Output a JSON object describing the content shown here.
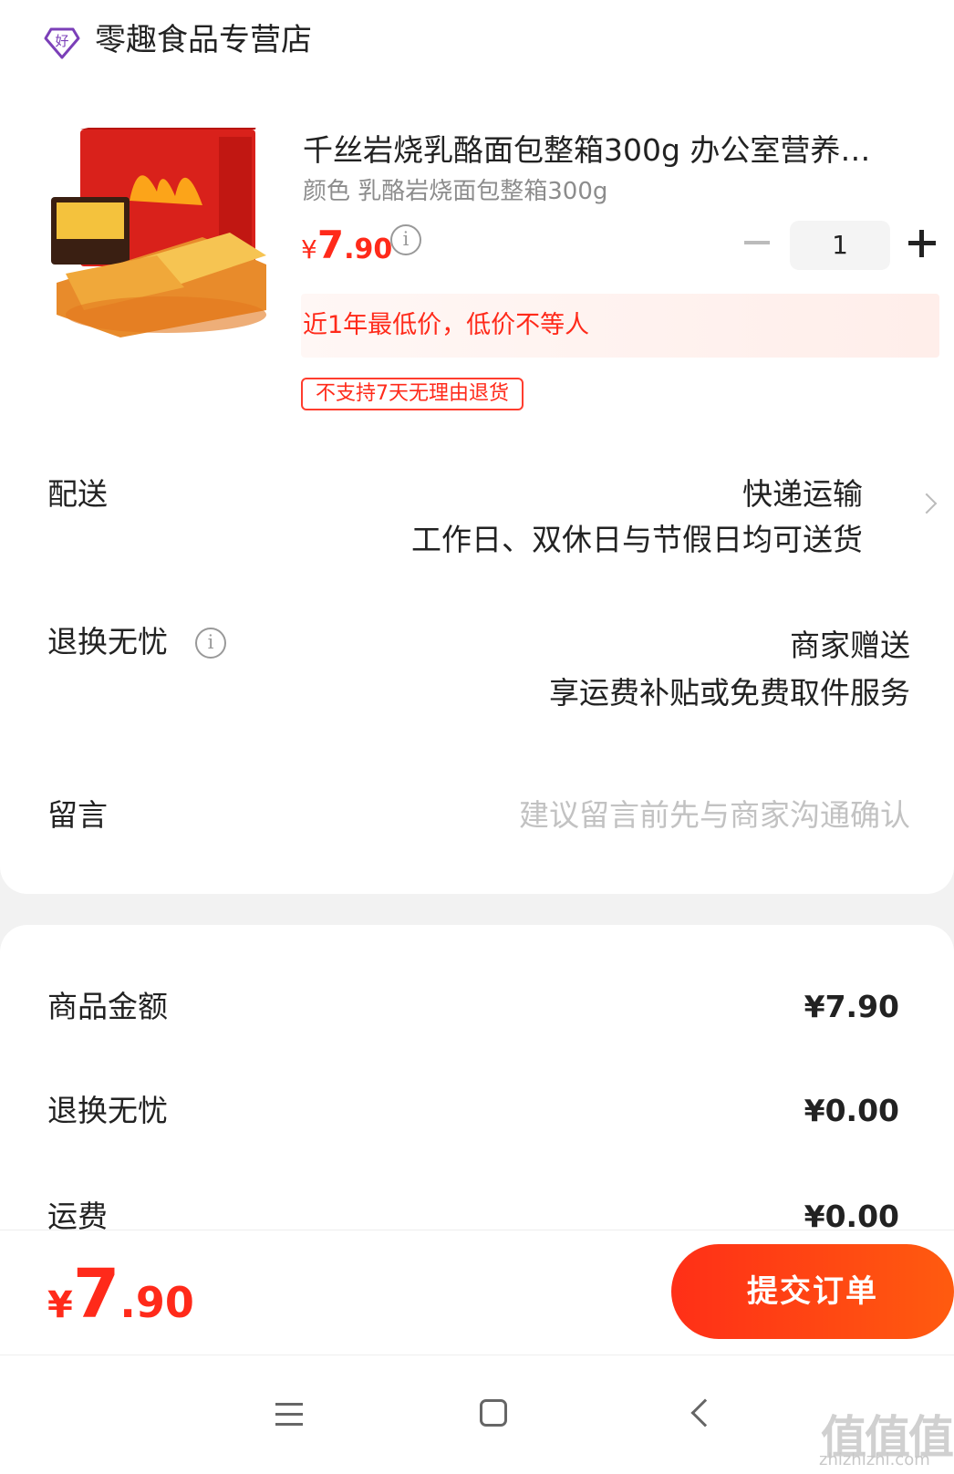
{
  "store": {
    "icon": "diamond-badge-icon",
    "badge_char": "好",
    "name": "零趣食品专营店"
  },
  "product": {
    "title": "千丝岩烧乳酪面包整箱300g 办公室营养…",
    "variant": "颜色 乳酪岩烧面包整箱300g",
    "price_currency": "¥",
    "price_int": "7",
    "price_dec": ".90",
    "quantity": "1",
    "banner": "近1年最低价，低价不等人",
    "tag": "不支持7天无理由退货",
    "image_icon": "product-image"
  },
  "delivery": {
    "label": "配送",
    "method": "快递运输",
    "detail": "工作日、双休日与节假日均可送货"
  },
  "returns": {
    "label": "退换无忧",
    "value": "商家赠送",
    "detail": "享运费补贴或免费取件服务"
  },
  "message": {
    "label": "留言",
    "placeholder": "建议留言前先与商家沟通确认"
  },
  "summary": {
    "items": [
      {
        "label": "商品金额",
        "value": "¥7.90"
      },
      {
        "label": "退换无忧",
        "value": "¥0.00"
      },
      {
        "label": "运费",
        "value": "¥0.00"
      }
    ]
  },
  "footer": {
    "total_currency": "¥",
    "total_int": "7",
    "total_dec": ".90",
    "submit_label": "提交订单"
  },
  "watermark": {
    "text": "值值值",
    "sub": "zhizhizhi.com"
  },
  "colors": {
    "accent": "#ff2a1a",
    "button_start": "#ff2f17",
    "button_end": "#ff5b0f",
    "store_icon": "#7b3fb8"
  }
}
